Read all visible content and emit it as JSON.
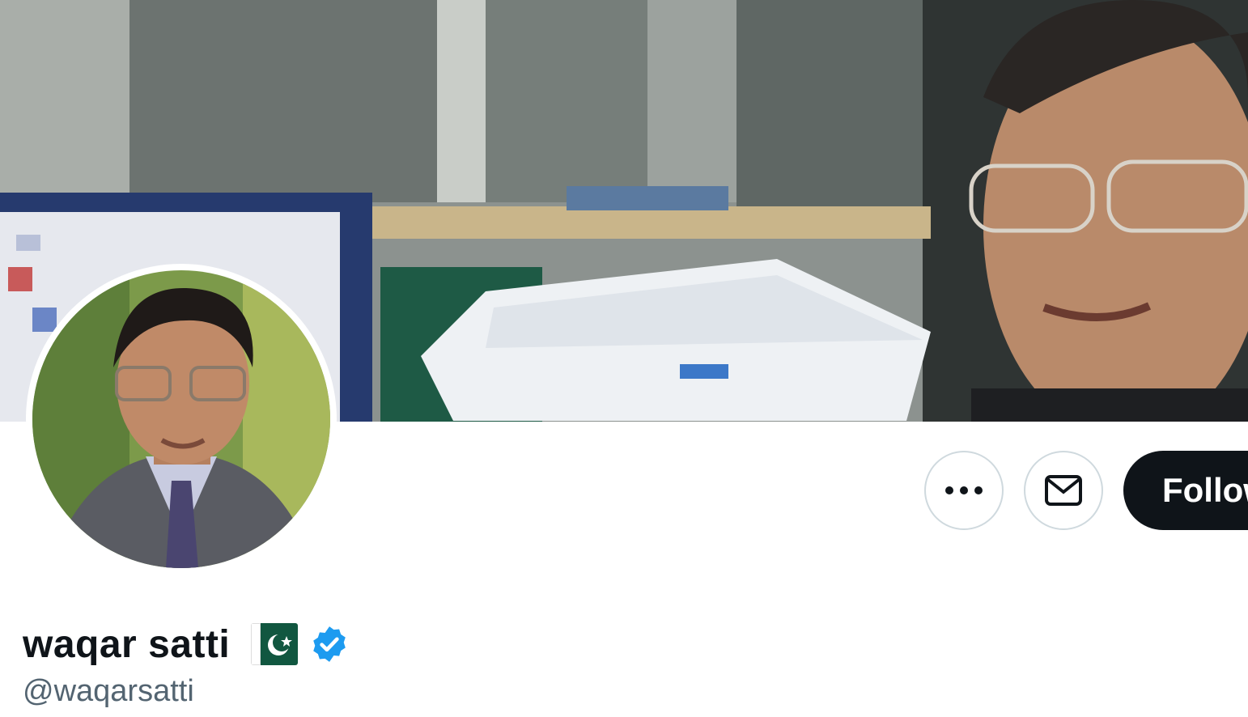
{
  "profile": {
    "display_name": "waqar satti",
    "handle": "@waqarsatti",
    "verified": true,
    "flag_emoji": "pakistan-flag-icon"
  },
  "actions": {
    "more_icon": "more-horizontal-icon",
    "message_icon": "envelope-icon",
    "follow_label": "Follow"
  },
  "colors": {
    "follow_button_bg": "#0f1419",
    "verified_badge": "#1d9bf0",
    "handle_text": "#536471"
  }
}
